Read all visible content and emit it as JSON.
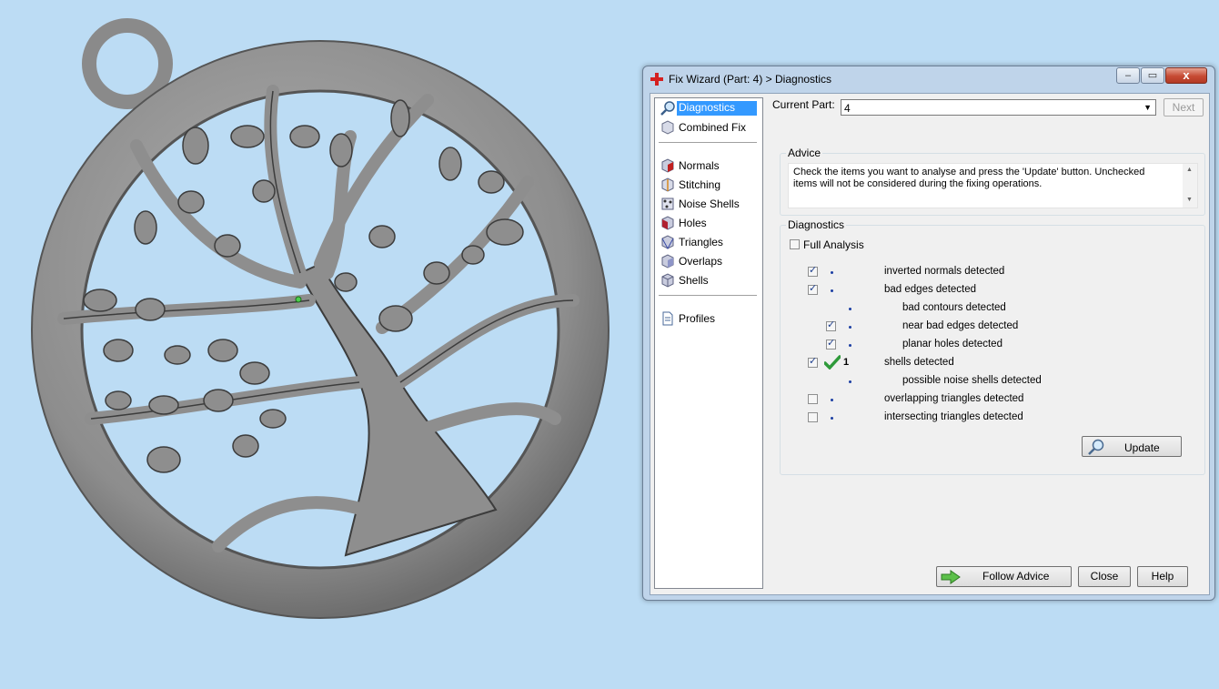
{
  "window": {
    "title": "Fix Wizard (Part: 4) > Diagnostics",
    "minimize_glyph": "‒",
    "maximize_glyph": "▭",
    "close_glyph": "x"
  },
  "nav": {
    "top_items": [
      {
        "label": "Diagnostics",
        "icon": "magnifier-icon",
        "selected": true
      },
      {
        "label": "Combined Fix",
        "icon": "cube-icon"
      }
    ],
    "fix_items": [
      {
        "label": "Normals",
        "icon": "normals-cube-icon"
      },
      {
        "label": "Stitching",
        "icon": "stitching-cube-icon"
      },
      {
        "label": "Noise Shells",
        "icon": "noise-shells-icon"
      },
      {
        "label": "Holes",
        "icon": "holes-cube-icon"
      },
      {
        "label": "Triangles",
        "icon": "triangles-cube-icon"
      },
      {
        "label": "Overlaps",
        "icon": "overlaps-cube-icon"
      },
      {
        "label": "Shells",
        "icon": "shells-cube-icon"
      }
    ],
    "bottom_items": [
      {
        "label": "Profiles",
        "icon": "document-icon"
      }
    ]
  },
  "current_part": {
    "label": "Current Part:",
    "value": "4"
  },
  "next_button": "Next",
  "advice": {
    "title": "Advice",
    "text": "Check the items you want to analyse and press the 'Update' button. Unchecked items will not be considered during the fixing operations."
  },
  "diagnostics": {
    "title": "Diagnostics",
    "full_analysis": {
      "label": "Full Analysis",
      "checked": false
    },
    "rows": [
      {
        "label": "inverted normals detected",
        "checked": true,
        "indent": 0
      },
      {
        "label": "bad edges detected",
        "checked": true,
        "indent": 0
      },
      {
        "label": "bad contours detected",
        "checkbox": false,
        "indent": 1
      },
      {
        "label": "near bad edges detected",
        "checked": true,
        "indent": 1
      },
      {
        "label": "planar holes detected",
        "checked": true,
        "indent": 1
      },
      {
        "label": "shells detected",
        "checked": true,
        "indent": 0,
        "status": "ok",
        "count": "1"
      },
      {
        "label": "possible noise shells detected",
        "checkbox": false,
        "indent": 1
      },
      {
        "label": "overlapping triangles detected",
        "checked": false,
        "indent": 0
      },
      {
        "label": "intersecting triangles detected",
        "checked": false,
        "indent": 0
      }
    ],
    "update_button": "Update"
  },
  "footer": {
    "follow_advice": "Follow Advice",
    "close": "Close",
    "help": "Help"
  },
  "colors": {
    "background": "#bcdcf4",
    "selection": "#3399ff",
    "model_gray": "#8a8a8a"
  }
}
